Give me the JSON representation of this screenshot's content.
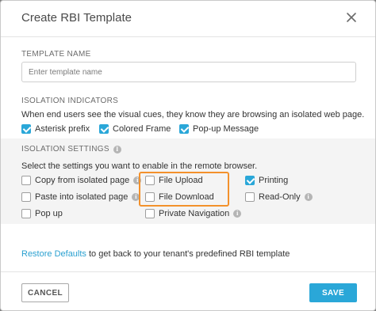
{
  "dialog": {
    "title": "Create RBI Template",
    "close_icon": "close-icon"
  },
  "template_name": {
    "label": "TEMPLATE NAME",
    "placeholder": "Enter template name",
    "value": ""
  },
  "isolation_indicators": {
    "label": "ISOLATION INDICATORS",
    "description": "When end users see the visual cues, they know they are browsing an isolated web page.",
    "options": [
      {
        "label": "Asterisk prefix",
        "checked": true
      },
      {
        "label": "Colored Frame",
        "checked": true
      },
      {
        "label": "Pop-up Message",
        "checked": true
      }
    ]
  },
  "isolation_settings": {
    "label": "ISOLATION SETTINGS",
    "description": "Select the settings you want to enable in the remote browser.",
    "options": [
      {
        "label": "Copy from isolated page",
        "checked": false,
        "info": true
      },
      {
        "label": "Paste into isolated page",
        "checked": false,
        "info": true
      },
      {
        "label": "Pop up",
        "checked": false,
        "info": false
      },
      {
        "label": "File Upload",
        "checked": false,
        "info": false
      },
      {
        "label": "File Download",
        "checked": false,
        "info": false
      },
      {
        "label": "Private Navigation",
        "checked": false,
        "info": true
      },
      {
        "label": "Printing",
        "checked": true,
        "info": false
      },
      {
        "label": "Read-Only",
        "checked": false,
        "info": true
      }
    ]
  },
  "restore": {
    "link": "Restore Defaults",
    "text": " to get back to your tenant's predefined RBI template"
  },
  "footer": {
    "cancel_label": "CANCEL",
    "save_label": "SAVE"
  },
  "colors": {
    "accent": "#2aa7d8",
    "highlight": "#f3912b"
  }
}
